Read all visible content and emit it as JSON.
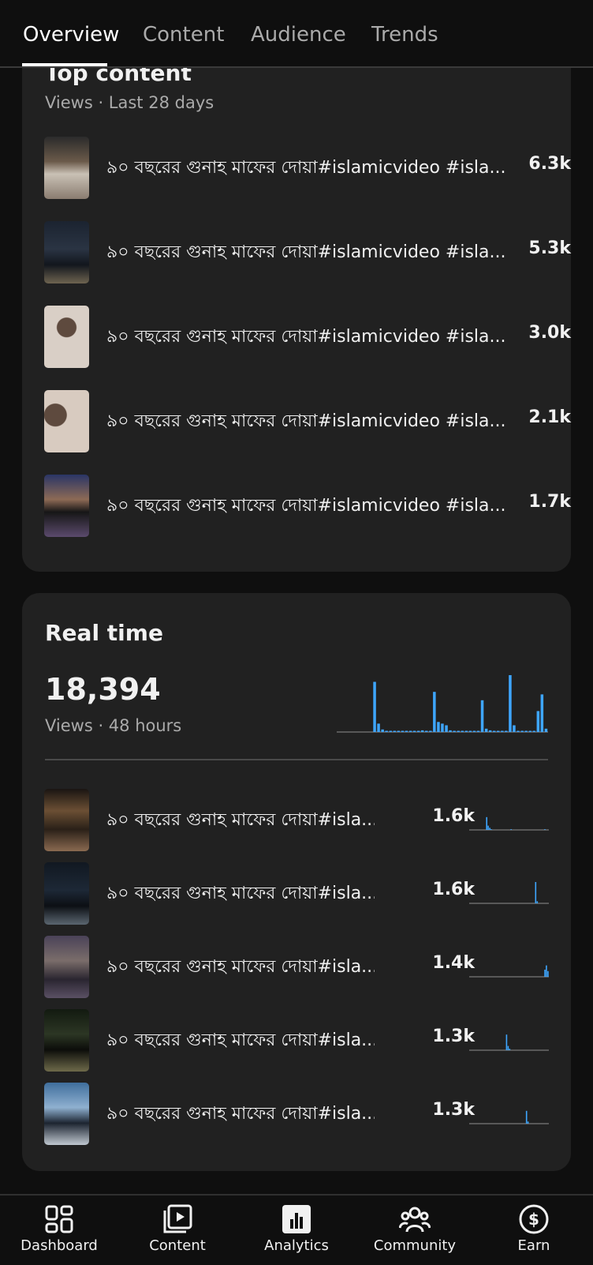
{
  "tabs": [
    {
      "label": "Overview",
      "active": true
    },
    {
      "label": "Content",
      "active": false
    },
    {
      "label": "Audience",
      "active": false
    },
    {
      "label": "Trends",
      "active": false
    }
  ],
  "top_content": {
    "title": "Top content",
    "subtitle": "Views · Last 28 days",
    "items": [
      {
        "title": "৯০ বছরের গুনাহ মাফের দোয়া#islamicvideo #isla...",
        "views": "6.3k"
      },
      {
        "title": "৯০ বছরের গুনাহ মাফের দোয়া#islamicvideo #isla...",
        "views": "5.3k"
      },
      {
        "title": "৯০ বছরের গুনাহ মাফের দোয়া#islamicvideo #isla...",
        "views": "3.0k"
      },
      {
        "title": "৯০ বছরের গুনাহ মাফের দোয়া#islamicvideo #isla...",
        "views": "2.1k"
      },
      {
        "title": "৯০ বছরের গুনাহ মাফের দোয়া#islamicvideo #isla...",
        "views": "1.7k"
      }
    ]
  },
  "real_time": {
    "title": "Real time",
    "total": "18,394",
    "subtitle": "Views · 48 hours",
    "accent_color": "#3ea6ff",
    "chart_data": {
      "type": "bar",
      "values": [
        0,
        0,
        0,
        0,
        0,
        0,
        0,
        0,
        0,
        60,
        10,
        3,
        1,
        1,
        1,
        1,
        1,
        1,
        1,
        1,
        1,
        2,
        1,
        1,
        48,
        12,
        10,
        8,
        2,
        1,
        1,
        1,
        1,
        1,
        1,
        1,
        38,
        4,
        2,
        1,
        1,
        1,
        1,
        68,
        8,
        1,
        1,
        1,
        1,
        1,
        25,
        45,
        4
      ]
    },
    "items": [
      {
        "title": "৯০ বছরের গুনাহ মাফের দোয়া#isla...",
        "views": "1.6k",
        "spark": [
          0,
          0,
          0,
          0,
          0,
          0,
          0,
          0,
          0,
          0,
          0,
          18,
          6,
          3,
          1,
          0,
          0,
          0,
          0,
          0,
          0,
          0,
          0,
          0,
          0,
          0,
          0,
          1,
          0,
          0,
          0,
          0,
          0,
          0,
          0,
          0,
          0,
          0,
          0,
          0,
          0,
          0,
          0,
          0,
          0,
          0,
          0,
          0,
          0,
          1,
          0,
          0
        ]
      },
      {
        "title": "৯০ বছরের গুনাহ মাফের দোয়া#isla...",
        "views": "1.6k",
        "spark": [
          0,
          0,
          0,
          0,
          0,
          0,
          0,
          0,
          0,
          0,
          0,
          0,
          0,
          0,
          0,
          0,
          0,
          0,
          0,
          0,
          0,
          0,
          0,
          0,
          0,
          0,
          0,
          0,
          0,
          0,
          0,
          0,
          0,
          0,
          0,
          0,
          0,
          0,
          0,
          0,
          0,
          0,
          0,
          30,
          3,
          0,
          0,
          0,
          0,
          0,
          0,
          0
        ]
      },
      {
        "title": "৯০ বছরের গুনাহ মাফের দোয়া#isla...",
        "views": "1.4k",
        "spark": [
          0,
          0,
          0,
          0,
          0,
          0,
          0,
          0,
          0,
          0,
          0,
          0,
          0,
          0,
          0,
          0,
          0,
          0,
          0,
          0,
          0,
          0,
          0,
          0,
          0,
          0,
          0,
          0,
          0,
          0,
          0,
          0,
          0,
          0,
          0,
          0,
          0,
          0,
          0,
          0,
          0,
          0,
          0,
          0,
          0,
          0,
          0,
          0,
          0,
          10,
          16,
          8
        ]
      },
      {
        "title": "৯০ বছরের গুনাহ মাফের দোয়া#isla...",
        "views": "1.3k",
        "spark": [
          0,
          0,
          0,
          0,
          0,
          0,
          0,
          0,
          0,
          0,
          0,
          0,
          0,
          0,
          0,
          0,
          0,
          0,
          0,
          0,
          0,
          0,
          0,
          0,
          22,
          6,
          2,
          0,
          0,
          0,
          0,
          0,
          0,
          0,
          0,
          0,
          0,
          0,
          0,
          0,
          0,
          0,
          0,
          0,
          0,
          0,
          0,
          0,
          0,
          0,
          0,
          0
        ]
      },
      {
        "title": "৯০ বছরের গুনাহ মাফের দোয়া#isla...",
        "views": "1.3k",
        "spark": [
          0,
          0,
          0,
          0,
          0,
          0,
          0,
          0,
          0,
          0,
          0,
          0,
          0,
          0,
          0,
          0,
          0,
          0,
          0,
          0,
          0,
          0,
          0,
          0,
          0,
          0,
          0,
          0,
          0,
          0,
          0,
          0,
          0,
          0,
          0,
          0,
          0,
          18,
          3,
          0,
          0,
          0,
          0,
          0,
          0,
          0,
          0,
          0,
          0,
          0,
          0,
          0
        ]
      }
    ]
  },
  "bottom_nav": [
    {
      "label": "Dashboard",
      "icon": "dashboard-icon"
    },
    {
      "label": "Content",
      "icon": "content-icon"
    },
    {
      "label": "Analytics",
      "icon": "analytics-icon"
    },
    {
      "label": "Community",
      "icon": "community-icon"
    },
    {
      "label": "Earn",
      "icon": "earn-icon"
    }
  ]
}
